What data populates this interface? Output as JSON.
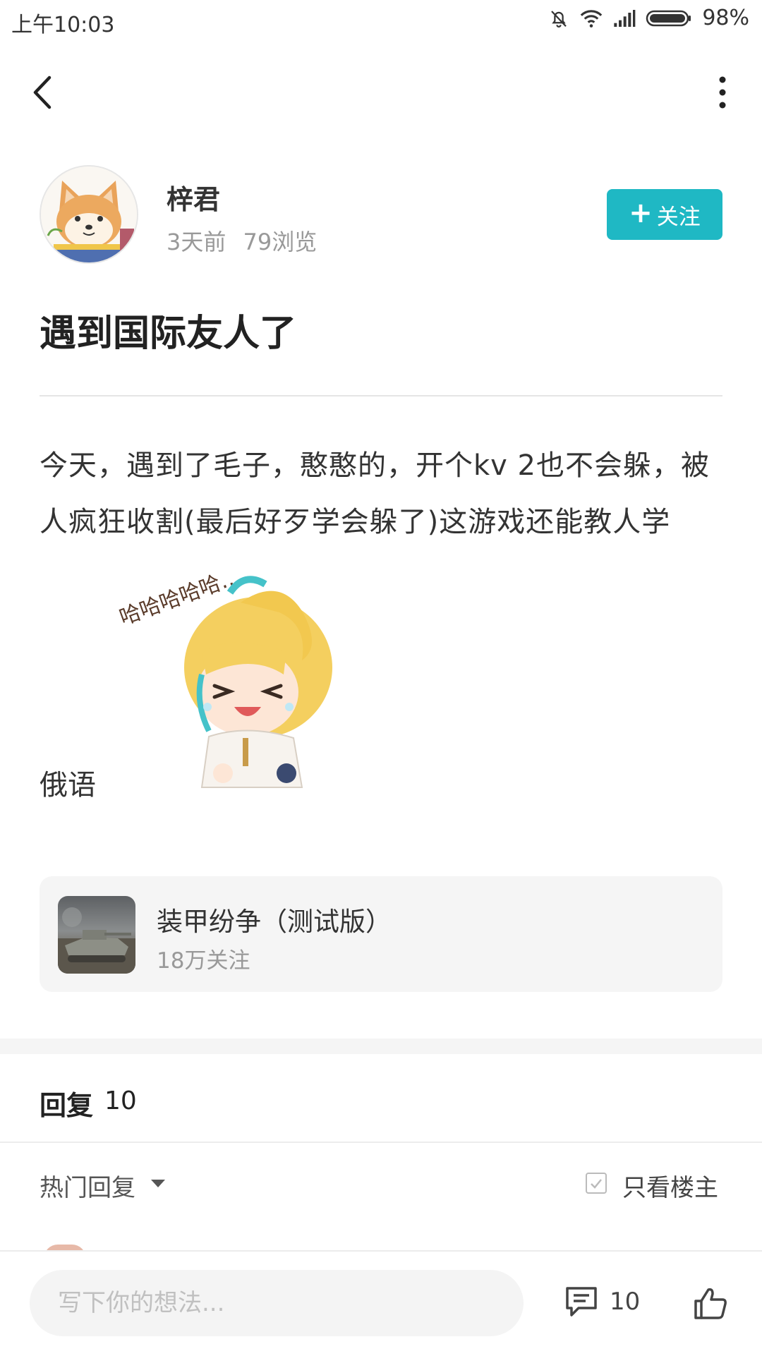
{
  "status_bar": {
    "time": "上午10:03",
    "battery": "98%",
    "icons": [
      "bell-off-icon",
      "wifi-icon",
      "signal-icon",
      "battery-icon"
    ]
  },
  "nav": {
    "icons": [
      "back-arrow-icon",
      "more-vertical-icon"
    ]
  },
  "author": {
    "name": "梓君",
    "meta": "3天前 79浏览",
    "follow_label": "关注",
    "follow_icon": "plus-icon",
    "accent_color": "#1fb8c4"
  },
  "post": {
    "title": "遇到国际友人了",
    "body": "今天，遇到了毛子，憨憨的，开个kv 2也不会躲，被人疯狂收割(最后好歹学会躲了)这游戏还能教人学",
    "body_tail": "俄语",
    "sticker_text": "哈哈哈哈哈…"
  },
  "game_card": {
    "name": "装甲纷争（测试版）",
    "followers": "18万关注"
  },
  "replies": {
    "label": "回复",
    "count": "10",
    "sort_label": "热门回复",
    "only_op_label": "只看楼主"
  },
  "bottom_bar": {
    "placeholder": "写下你的想法...",
    "comment_count": "10",
    "icons": [
      "comment-icon",
      "thumbs-up-icon"
    ]
  }
}
